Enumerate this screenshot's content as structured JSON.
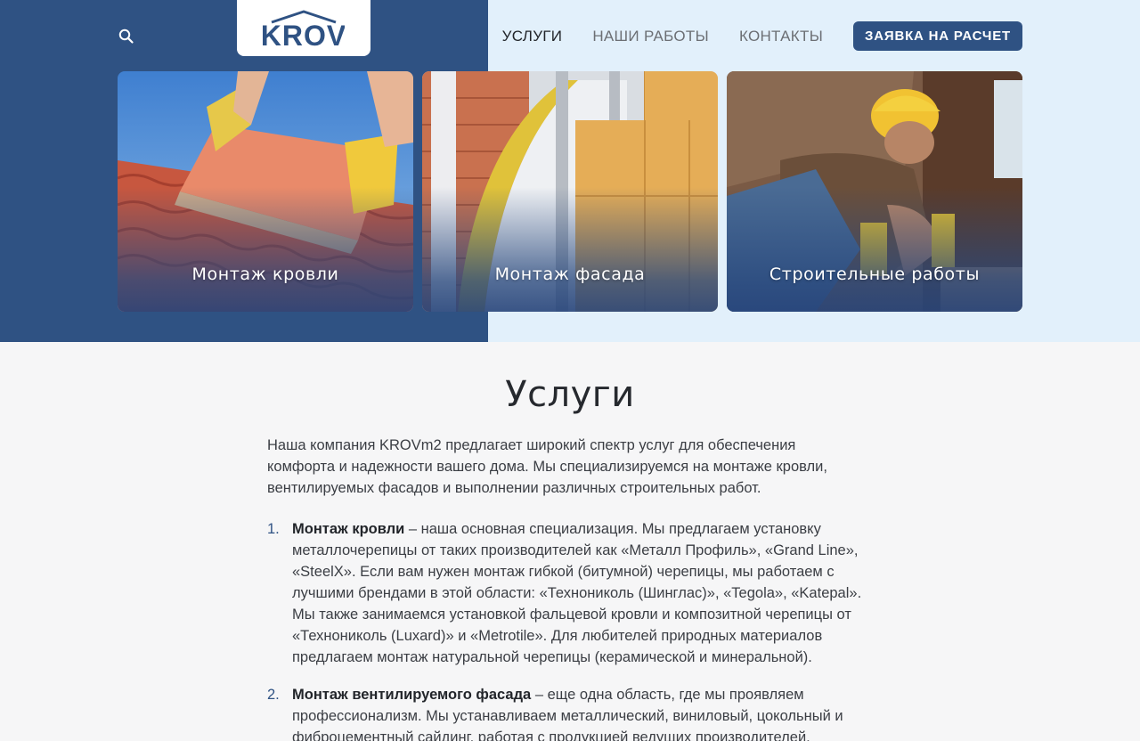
{
  "header": {
    "logo_text": "KROV",
    "nav": [
      {
        "label": "УСЛУГИ",
        "active": true
      },
      {
        "label": "НАШИ РАБОТЫ",
        "active": false
      },
      {
        "label": "КОНТАКТЫ",
        "active": false
      }
    ],
    "cta_label": "ЗАЯВКА НА РАСЧЕТ",
    "search_icon": "search-icon"
  },
  "cards": [
    {
      "title": "Монтаж кровли"
    },
    {
      "title": "Монтаж фасада"
    },
    {
      "title": "Строительные работы"
    }
  ],
  "services": {
    "title": "Услуги",
    "intro": "Наша компания KROVm2 предлагает широкий спектр услуг для обеспечения комфорта и надежности вашего дома. Мы специализируемся на монтаже кровли, вентилируемых фасадов и выполнении различных строительных работ.",
    "items": [
      {
        "num": "1.",
        "heading": "Монтаж кровли",
        "text": " – наша основная специализация. Мы предлагаем установку металлочерепицы от таких производителей как «Металл Профиль», «Grand Line», «SteelX». Если вам нужен монтаж гибкой (битумной) черепицы, мы работаем с лучшими брендами в этой области: «Технониколь (Шинглас)», «Tegola», «Katepal». Мы также занимаемся установкой фальцевой кровли и композитной черепицы от «Технониколь (Luxard)» и «Metrotile». Для любителей природных материалов предлагаем монтаж натуральной черепицы (керамической и минеральной)."
      },
      {
        "num": "2.",
        "heading": "Монтаж вентилируемого фасада",
        "text": " – еще одна область, где мы проявляем профессионализм. Мы устанавливаем металлический, виниловый, цокольный и фиброцементный сайдинг, работая с продукцией ведущих производителей."
      }
    ]
  },
  "colors": {
    "brand_blue": "#2f5283",
    "light_blue": "#e2f0fb",
    "page_bg": "#f6f6f7"
  }
}
